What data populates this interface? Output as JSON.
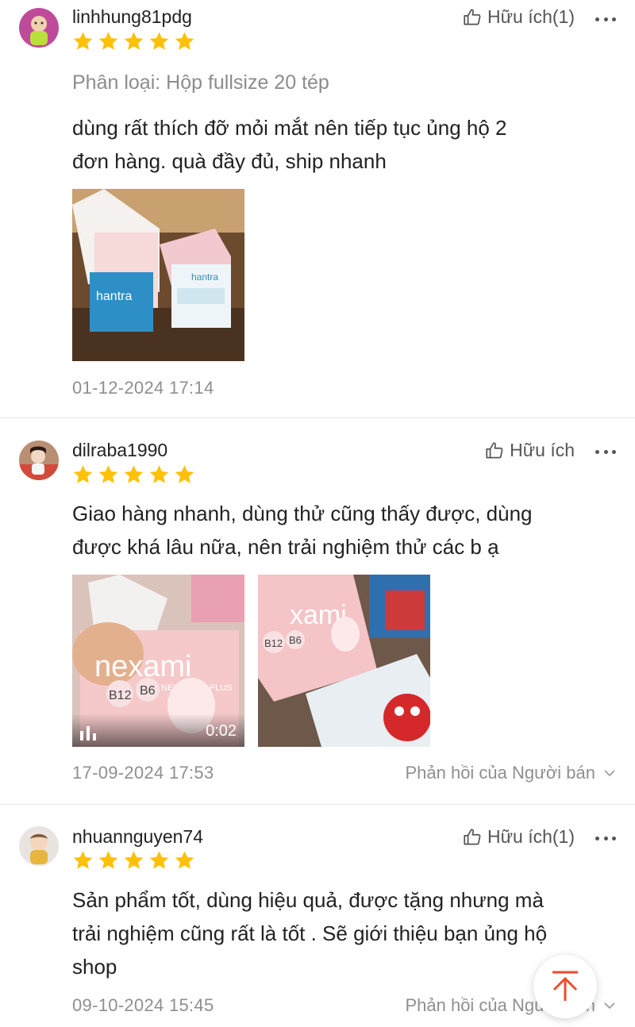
{
  "colors": {
    "star": "#ffc107",
    "accent": "#ee4d2d",
    "muted": "#8f8f8f"
  },
  "reviews": [
    {
      "username": "linhhung81pdg",
      "rating": 5,
      "helpful_label": "Hữu ích(1)",
      "variation": "Phân loại: Hộp fullsize 20 tép",
      "text_lines": [
        "dùng rất thích đỡ mỏi mắt nên tiếp tục ủng hộ 2",
        "đơn hàng. quà đầy đủ, ship nhanh"
      ],
      "media": [
        {
          "type": "photo",
          "description_icon": "product-photo"
        }
      ],
      "date": "01-12-2024 17:14"
    },
    {
      "username": "dilraba1990",
      "rating": 5,
      "helpful_label": "Hữu ích",
      "text_lines": [
        "Giao hàng nhanh, dùng thử cũng thấy được, dùng",
        "được khá lâu nữa, nên trải nghiệm thử các b ạ"
      ],
      "media": [
        {
          "type": "video",
          "duration": "0:02",
          "brand_text": "nexami",
          "sub_text": "NEWLIGHT PLUS",
          "vitamins": [
            "B12",
            "B6"
          ]
        },
        {
          "type": "photo",
          "brand_text": "xami",
          "vitamins": [
            "B12",
            "B6"
          ]
        }
      ],
      "date": "17-09-2024 17:53",
      "seller_reply_label": "Phản hồi của Người bán"
    },
    {
      "username": "nhuannguyen74",
      "rating": 5,
      "helpful_label": "Hữu ích(1)",
      "text_lines": [
        "Sản phẩm tốt, dùng hiệu quả, được tặng nhưng mà",
        "trải nghiệm cũng rất là tốt . Sẽ giới thiệu bạn ủng hộ",
        "shop"
      ],
      "date": "09-10-2024 15:45",
      "seller_reply_label": "Phản hồi của Người bán"
    }
  ],
  "photo1_labels": [
    "hantra",
    "hantra"
  ]
}
